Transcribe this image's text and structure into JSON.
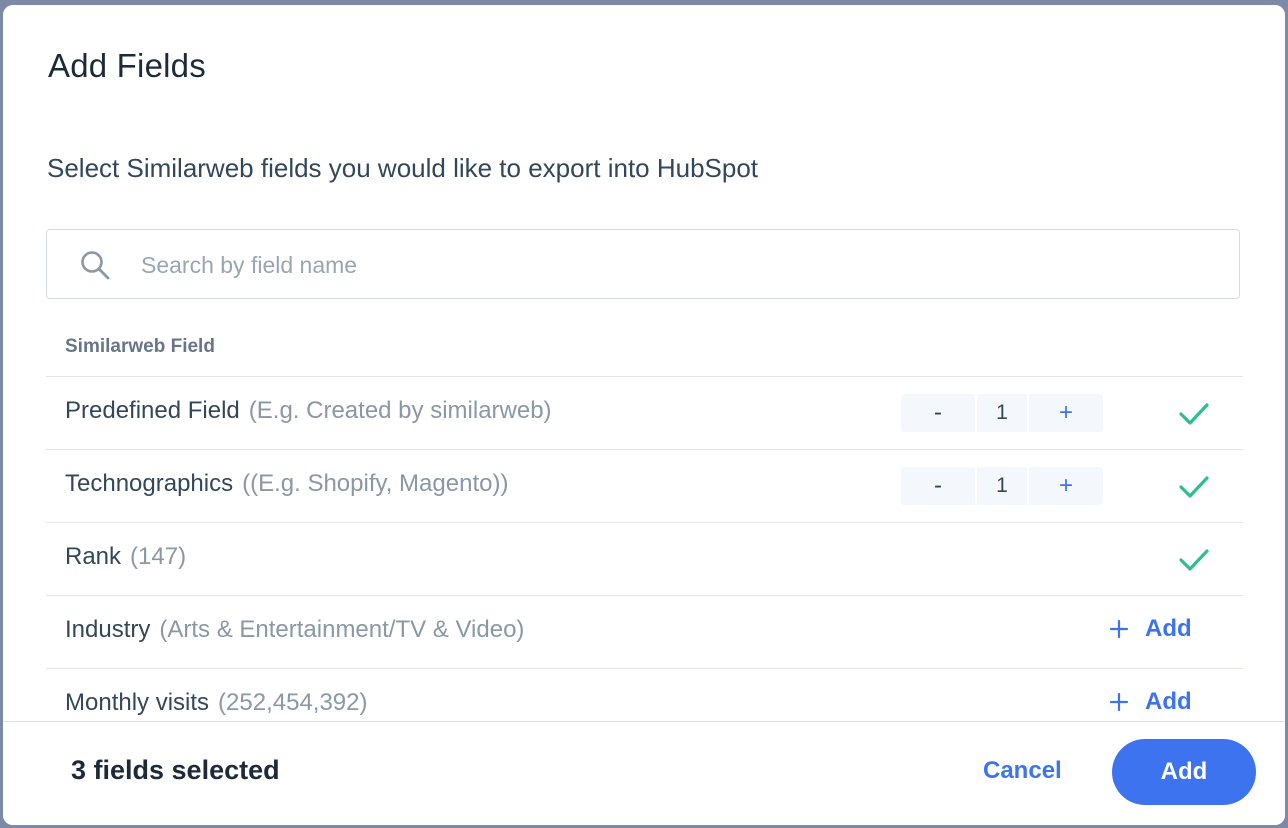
{
  "dialog": {
    "title": "Add Fields",
    "subtitle": "Select Similarweb fields you would like to export into HubSpot"
  },
  "search": {
    "placeholder": "Search by field name",
    "value": "",
    "icon": "search-icon"
  },
  "table": {
    "column_header": "Similarweb Field",
    "rows": [
      {
        "name": "Predefined Field",
        "example": "(E.g. Created by similarweb)",
        "state": "selected",
        "stepper": {
          "minus": "-",
          "value": "1",
          "plus": "+"
        }
      },
      {
        "name": "Technographics",
        "example": "((E.g. Shopify, Magento))",
        "state": "selected",
        "stepper": {
          "minus": "-",
          "value": "1",
          "plus": "+"
        }
      },
      {
        "name": "Rank",
        "example": "(147)",
        "state": "selected"
      },
      {
        "name": "Industry",
        "example": "(Arts & Entertainment/TV & Video)",
        "state": "unselected",
        "action_label": "Add"
      },
      {
        "name": "Monthly visits",
        "example": "(252,454,392)",
        "state": "unselected",
        "action_label": "Add"
      }
    ]
  },
  "footer": {
    "selected_count": "3 fields selected",
    "cancel_label": "Cancel",
    "add_label": "Add"
  },
  "colors": {
    "accent": "#3e73ef",
    "check": "#2dbf8c",
    "backdrop": "#7c8aa8"
  }
}
